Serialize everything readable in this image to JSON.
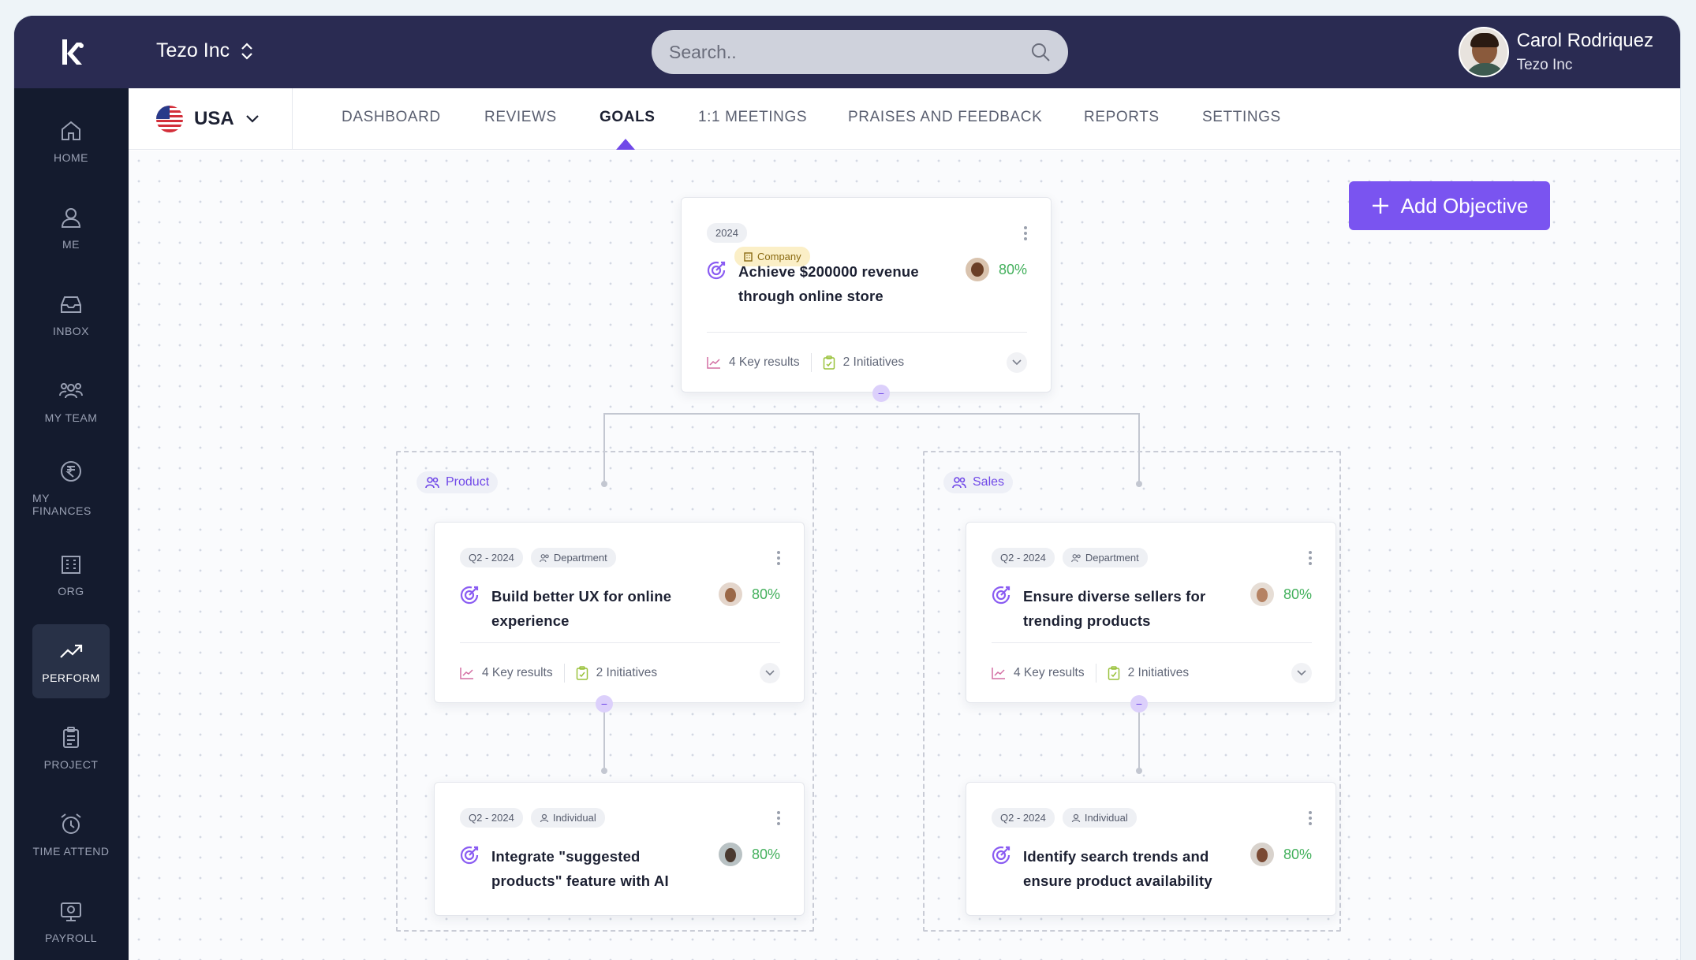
{
  "company": {
    "name": "Tezo Inc"
  },
  "search": {
    "placeholder": "Search.."
  },
  "user": {
    "name": "Carol Rodriquez",
    "org": "Tezo Inc"
  },
  "country": {
    "name": "USA"
  },
  "sidebar": {
    "items": [
      {
        "label": "HOME",
        "icon": "home-icon"
      },
      {
        "label": "ME",
        "icon": "user-icon"
      },
      {
        "label": "INBOX",
        "icon": "inbox-icon"
      },
      {
        "label": "MY TEAM",
        "icon": "team-icon"
      },
      {
        "label": "MY FINANCES",
        "icon": "rupee-icon"
      },
      {
        "label": "ORG",
        "icon": "building-icon"
      },
      {
        "label": "PERFORM",
        "icon": "trend-up-icon",
        "active": true
      },
      {
        "label": "PROJECT",
        "icon": "clipboard-icon"
      },
      {
        "label": "TIME ATTEND",
        "icon": "alarm-clock-icon"
      },
      {
        "label": "PAYROLL",
        "icon": "payroll-icon"
      }
    ]
  },
  "tabs": [
    {
      "label": "DASHBOARD"
    },
    {
      "label": "REVIEWS"
    },
    {
      "label": "GOALS",
      "active": true
    },
    {
      "label": "1:1 MEETINGS"
    },
    {
      "label": "PRAISES AND FEEDBACK"
    },
    {
      "label": "REPORTS"
    },
    {
      "label": "SETTINGS"
    }
  ],
  "actions": {
    "add_objective": "Add Objective"
  },
  "groups": [
    {
      "label": "Product"
    },
    {
      "label": "Sales"
    }
  ],
  "goals": {
    "root": {
      "period": "2024",
      "type": "Company",
      "title": "Achieve $200000 revenue through online store",
      "progress": "80%",
      "key_results": "4 Key results",
      "initiatives": "2 Initiatives"
    },
    "product_dept": {
      "period": "Q2 - 2024",
      "type": "Department",
      "title": "Build better UX for online experience",
      "progress": "80%",
      "key_results": "4 Key results",
      "initiatives": "2 Initiatives"
    },
    "sales_dept": {
      "period": "Q2 - 2024",
      "type": "Department",
      "title": "Ensure diverse sellers for trending products",
      "progress": "80%",
      "key_results": "4 Key results",
      "initiatives": "2 Initiatives"
    },
    "product_ind": {
      "period": "Q2 - 2024",
      "type": "Individual",
      "title": "Integrate \"suggested products\" feature with AI",
      "progress": "80%"
    },
    "sales_ind": {
      "period": "Q2 - 2024",
      "type": "Individual",
      "title": "Identify search trends and ensure product availability",
      "progress": "80%"
    }
  },
  "colors": {
    "accent": "#7a54f0",
    "header": "#2a2b52",
    "sidebar": "#141b2e",
    "success": "#43b05c"
  }
}
